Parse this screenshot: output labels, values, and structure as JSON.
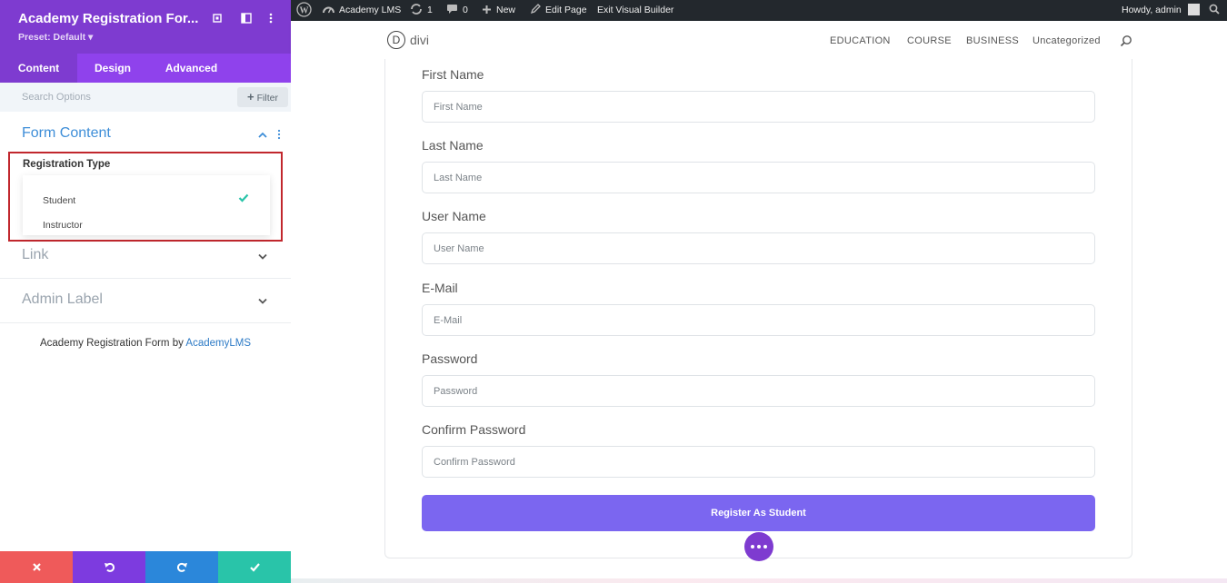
{
  "panel": {
    "title": "Academy Registration For...",
    "preset": "Preset: Default ▾",
    "tabs": [
      "Content",
      "Design",
      "Advanced"
    ],
    "search_placeholder": "Search Options",
    "filter_label": "Filter"
  },
  "form_content": {
    "title": "Form Content",
    "registration_label": "Registration Type",
    "options": [
      "Student",
      "Instructor"
    ],
    "selected": "Student"
  },
  "sections": {
    "link": "Link",
    "admin_label": "Admin Label"
  },
  "credit": {
    "prefix": "Academy Registration Form by ",
    "link": "AcademyLMS"
  },
  "adminbar": {
    "site": "Academy LMS",
    "updates": "1",
    "comments": "0",
    "new": "New",
    "edit_page": "Edit Page",
    "exit_builder": "Exit Visual Builder",
    "howdy": "Howdy, admin"
  },
  "site_nav": {
    "logo_letter": "D",
    "logo_text": "divi",
    "links": [
      "EDUCATION",
      "COURSE",
      "BUSINESS",
      "Uncategorized"
    ]
  },
  "form": {
    "fields": [
      {
        "label": "First Name",
        "placeholder": "First Name"
      },
      {
        "label": "Last Name",
        "placeholder": "Last Name"
      },
      {
        "label": "User Name",
        "placeholder": "User Name"
      },
      {
        "label": "E-Mail",
        "placeholder": "E-Mail"
      },
      {
        "label": "Password",
        "placeholder": "Password"
      },
      {
        "label": "Confirm Password",
        "placeholder": "Confirm Password"
      }
    ],
    "submit_label": "Register As Student"
  },
  "colors": {
    "panel_purple": "#7e3bd0",
    "tab_purple": "#8f42ec",
    "register_button": "#7b66f0",
    "highlight_red": "#c1272d",
    "check_green": "#29c4a9"
  }
}
